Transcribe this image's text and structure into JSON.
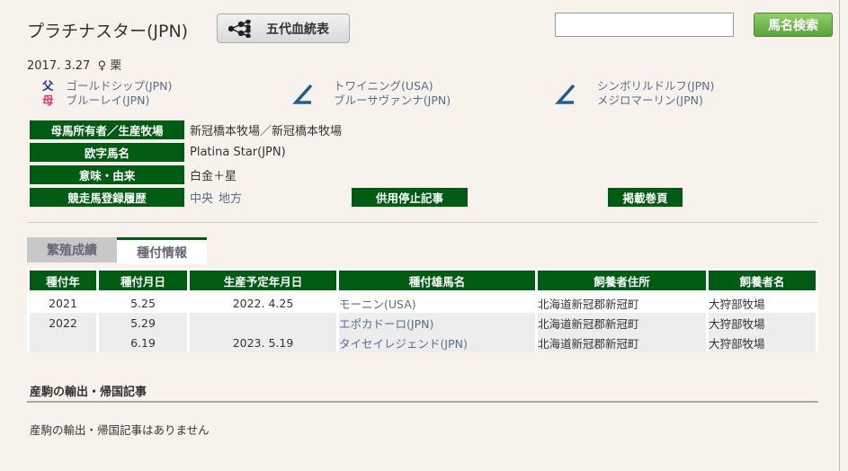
{
  "horse": {
    "name": "プラチナスター(JPN)",
    "birth": "2017. 3.27",
    "sex_symbol": "♀",
    "color": "栗"
  },
  "buttons": {
    "pedigree": "五代血統表",
    "search": "馬名検索"
  },
  "search": {
    "value": ""
  },
  "parents": {
    "sire_label": "父",
    "dam_label": "母",
    "sire": "ゴールドシップ(JPN)",
    "dam": "ブルーレイ(JPN)",
    "dam_sire": "トワイニング(USA)",
    "dam_dam": "ブルーサヴァンナ(JPN)",
    "dam3_sire": "シンボリルドルフ(JPN)",
    "dam3_dam": "メジロマーリン(JPN)"
  },
  "details": [
    {
      "label": "母馬所有者／生産牧場",
      "value": "新冠橋本牧場／新冠橋本牧場"
    },
    {
      "label": "欧字馬名",
      "value": "Platina Star(JPN)"
    },
    {
      "label": "意味・由来",
      "value": "白金＋星"
    },
    {
      "label": "競走馬登録履歴",
      "links": [
        "中央",
        "地方"
      ],
      "extra": [
        "供用停止記事",
        "掲載巻頁"
      ]
    }
  ],
  "tabs": [
    "繁殖成績",
    "種付情報"
  ],
  "table": {
    "headers": [
      "種付年",
      "種付月日",
      "生産予定年月日",
      "種付雄馬名",
      "飼養者住所",
      "飼養者名"
    ],
    "rows": [
      [
        "2021",
        "5.25",
        "2022. 4.25",
        "モーニン(USA)",
        "北海道新冠郡新冠町",
        "大狩部牧場"
      ],
      [
        "2022",
        "5.29",
        "",
        "エポカドーロ(JPN)",
        "北海道新冠郡新冠町",
        "大狩部牧場"
      ],
      [
        "",
        "6.19",
        "2023. 5.19",
        "タイセイレジェンド(JPN)",
        "北海道新冠郡新冠町",
        "大狩部牧場"
      ]
    ]
  },
  "export": {
    "title": "産駒の輸出・帰国記事",
    "empty": "産駒の輸出・帰国記事はありません"
  }
}
